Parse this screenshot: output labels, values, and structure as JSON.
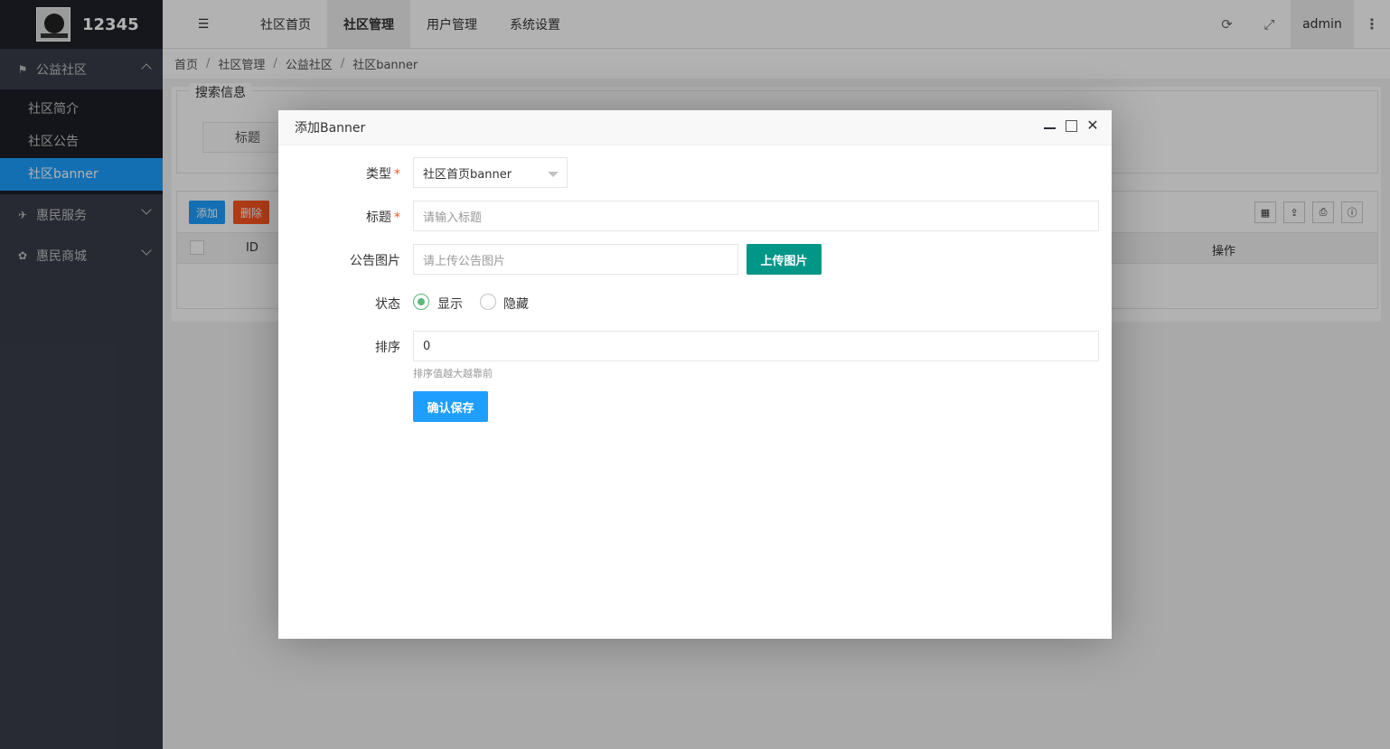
{
  "app": {
    "logo_text": "12345"
  },
  "sidebar": {
    "groups": [
      {
        "label": "公益社区",
        "icon": "flag-icon",
        "open": true,
        "items": [
          {
            "label": "社区简介"
          },
          {
            "label": "社区公告"
          },
          {
            "label": "社区banner",
            "active": true
          }
        ]
      },
      {
        "label": "惠民服务",
        "icon": "plane-icon"
      },
      {
        "label": "惠民商城",
        "icon": "flower-icon"
      }
    ]
  },
  "header": {
    "tabs": [
      {
        "label": "社区首页"
      },
      {
        "label": "社区管理",
        "active": true
      },
      {
        "label": "用户管理"
      },
      {
        "label": "系统设置"
      }
    ],
    "user": "admin"
  },
  "breadcrumb": [
    "首页",
    "社区管理",
    "公益社区",
    "社区banner"
  ],
  "search": {
    "legend": "搜索信息",
    "title_label": "标题"
  },
  "table": {
    "add_label": "添加",
    "delete_label": "删除",
    "columns": {
      "id": "ID",
      "action": "操作"
    }
  },
  "modal": {
    "title": "添加Banner",
    "type_label": "类型",
    "type_value": "社区首页banner",
    "title_label": "标题",
    "title_placeholder": "请输入标题",
    "image_label": "公告图片",
    "image_placeholder": "请上传公告图片",
    "upload_label": "上传图片",
    "status_label": "状态",
    "status_show": "显示",
    "status_hide": "隐藏",
    "status_selected": "显示",
    "sort_label": "排序",
    "sort_value": "0",
    "sort_help": "排序值越大越靠前",
    "save_label": "确认保存"
  },
  "colors": {
    "primary": "#1e9fff",
    "teal": "#009688",
    "danger": "#ff5722",
    "sidebar": "#393d49",
    "radio_on": "#5fb878"
  }
}
